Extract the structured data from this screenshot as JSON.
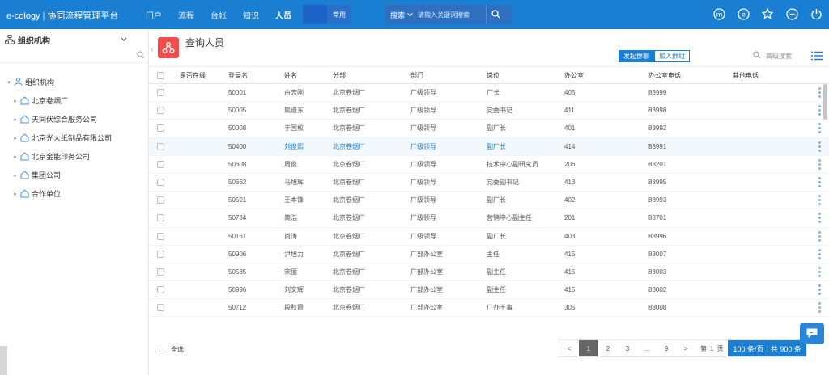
{
  "app": {
    "brand": "e-cology",
    "platform": "协同流程管理平台",
    "nav": [
      "门户",
      "流程",
      "台帐",
      "知识",
      "人员"
    ],
    "nav_active": "人员",
    "nav_common": "常用",
    "search_type": "搜索",
    "search_placeholder": "请输入关键词搜索"
  },
  "sidebar": {
    "title": "组织机构",
    "root": "组织机构",
    "items": [
      "北京卷烟厂",
      "天同伏综合服务公司",
      "北京光大纸制品有限公司",
      "北京金能印务公司",
      "集团公司",
      "合作单位"
    ]
  },
  "page": {
    "title": "查询人员",
    "tab_send": "发起群聊",
    "tab_group": "加入群组",
    "advanced": "高级搜索"
  },
  "table": {
    "headers": [
      "是否在线",
      "登录名",
      "姓名",
      "分部",
      "部门",
      "岗位",
      "办公室",
      "办公室电话",
      "其他电话"
    ],
    "rows": [
      {
        "login": "50001",
        "name": "由志刚",
        "branch": "北京卷烟厂",
        "dept": "厂级领导",
        "pos": "厂长",
        "office": "405",
        "phone": "88999",
        "other": ""
      },
      {
        "login": "50005",
        "name": "熊遵东",
        "branch": "北京卷烟厂",
        "dept": "厂级领导",
        "pos": "党委书记",
        "office": "411",
        "phone": "88998",
        "other": ""
      },
      {
        "login": "50008",
        "name": "于国权",
        "branch": "北京卷烟厂",
        "dept": "厂级领导",
        "pos": "副厂长",
        "office": "401",
        "phone": "88992",
        "other": ""
      },
      {
        "login": "50400",
        "name": "刘俊熙",
        "branch": "北京卷烟厂",
        "dept": "厂级领导",
        "pos": "副厂长",
        "office": "414",
        "phone": "88991",
        "other": ""
      },
      {
        "login": "50608",
        "name": "周俊",
        "branch": "北京卷烟厂",
        "dept": "厂级领导",
        "pos": "技术中心副研究员",
        "office": "206",
        "phone": "88201",
        "other": ""
      },
      {
        "login": "50662",
        "name": "马旭辉",
        "branch": "北京卷烟厂",
        "dept": "厂级领导",
        "pos": "党委副书记",
        "office": "413",
        "phone": "88995",
        "other": ""
      },
      {
        "login": "50591",
        "name": "王本锋",
        "branch": "北京卷烟厂",
        "dept": "厂级领导",
        "pos": "副厂长",
        "office": "402",
        "phone": "88993",
        "other": ""
      },
      {
        "login": "50784",
        "name": "简浩",
        "branch": "北京卷烟厂",
        "dept": "厂级领导",
        "pos": "营销中心副主任",
        "office": "201",
        "phone": "88701",
        "other": ""
      },
      {
        "login": "50161",
        "name": "尚涛",
        "branch": "北京卷烟厂",
        "dept": "厂级领导",
        "pos": "副厂长",
        "office": "403",
        "phone": "88996",
        "other": ""
      },
      {
        "login": "50906",
        "name": "尹旭力",
        "branch": "北京卷烟厂",
        "dept": "厂部办公室",
        "pos": "主任",
        "office": "415",
        "phone": "88007",
        "other": ""
      },
      {
        "login": "50585",
        "name": "宋丽",
        "branch": "北京卷烟厂",
        "dept": "厂部办公室",
        "pos": "副主任",
        "office": "415",
        "phone": "88003",
        "other": ""
      },
      {
        "login": "50996",
        "name": "刘文辉",
        "branch": "北京卷烟厂",
        "dept": "厂部办公室",
        "pos": "副主任",
        "office": "415",
        "phone": "88002",
        "other": ""
      },
      {
        "login": "50712",
        "name": "段秋霞",
        "branch": "北京卷烟厂",
        "dept": "厂部办公室",
        "pos": "厂办干事",
        "office": "305",
        "phone": "88008",
        "other": ""
      }
    ]
  },
  "footer": {
    "select_all": "全选",
    "prev": "<",
    "pages": [
      "1",
      "2",
      "3",
      "...",
      "9"
    ],
    "current_page": "1",
    "next": ">",
    "goto_prefix": "第",
    "goto_value": "1",
    "goto_suffix": "页",
    "page_size": "100 条/页",
    "total": "共 900 条"
  }
}
